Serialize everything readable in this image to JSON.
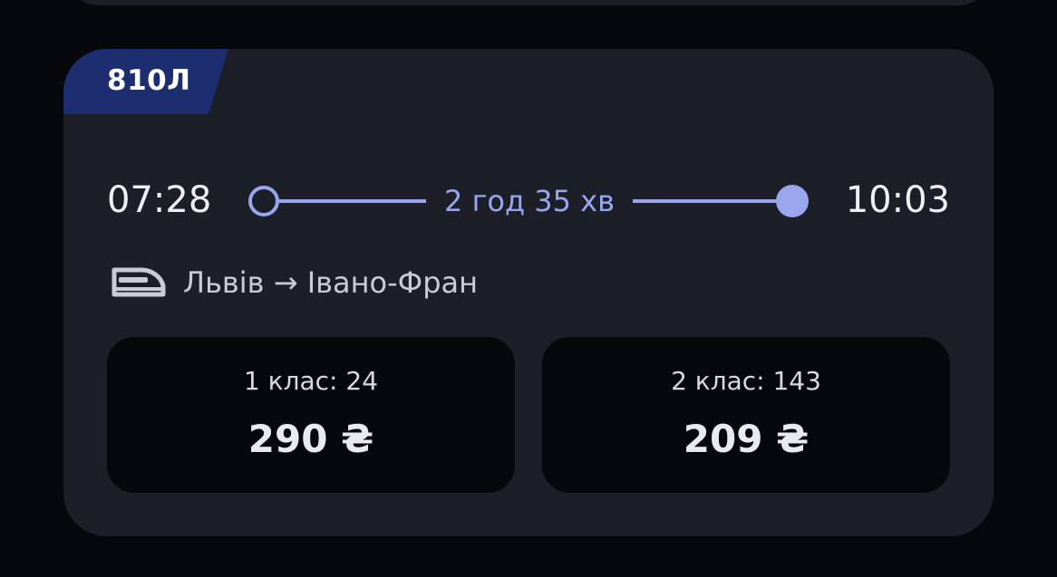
{
  "train": {
    "number": "810Л",
    "departure_time": "07:28",
    "arrival_time": "10:03",
    "duration": "2 год 35 хв",
    "route": "Львів → Івано-Фран"
  },
  "fares": [
    {
      "class_label": "1 клас: 24",
      "price": "290 ₴"
    },
    {
      "class_label": "2 клас: 143",
      "price": "209 ₴"
    }
  ],
  "icons": {
    "train": "train-icon"
  },
  "colors": {
    "background": "#07080c",
    "card": "#1c1f27",
    "badge": "#1c2d70",
    "accent": "#9aa6ec"
  }
}
